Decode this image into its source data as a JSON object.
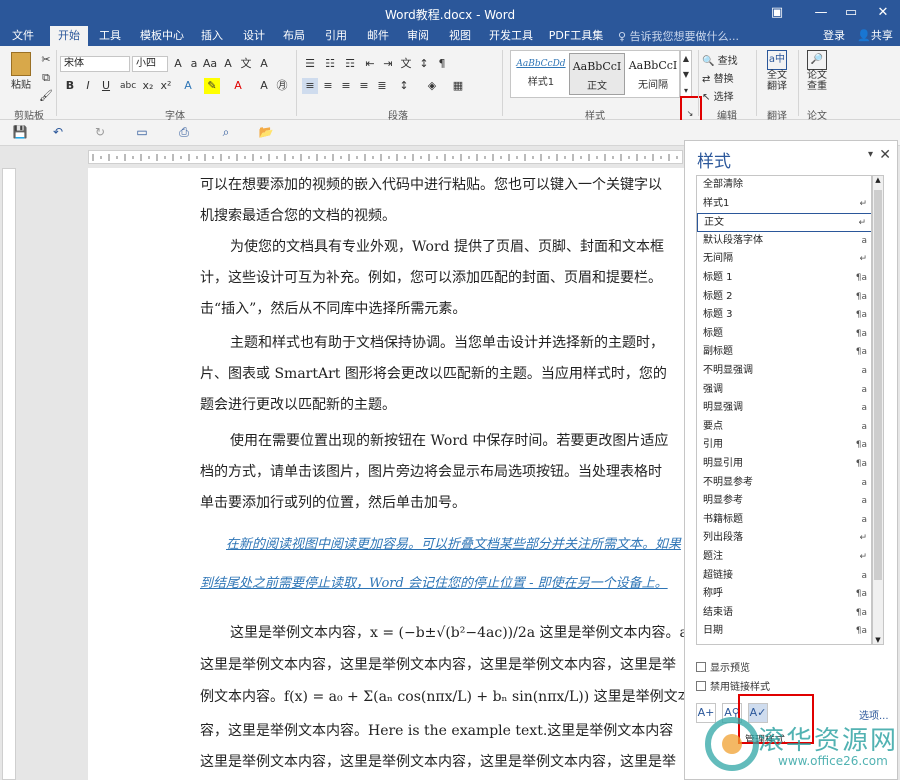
{
  "window": {
    "title": "Word教程.docx - Word"
  },
  "tabs": [
    "文件",
    "开始",
    "工具",
    "模板中心",
    "插入",
    "设计",
    "布局",
    "引用",
    "邮件",
    "审阅",
    "视图",
    "开发工具",
    "PDF工具集"
  ],
  "tellme": "告诉我您想要做什么...",
  "account": {
    "login": "登录",
    "share": "共享"
  },
  "ribbon": {
    "clipboard": {
      "paste": "粘贴",
      "label": "剪贴板"
    },
    "font": {
      "name": "宋体",
      "size": "小四",
      "label": "字体"
    },
    "paragraph": {
      "label": "段落"
    },
    "styles": {
      "label": "样式",
      "gallery": [
        {
          "preview": "AaBbCcDd",
          "name": "样式1"
        },
        {
          "preview": "AaBbCcI",
          "name": "正文"
        },
        {
          "preview": "AaBbCcI",
          "name": "无间隔"
        }
      ]
    },
    "editing": {
      "find": "查找",
      "replace": "替换",
      "select": "选择",
      "label": "编辑"
    },
    "translate": {
      "button": "全文翻译",
      "label": "翻译"
    },
    "paper": {
      "button": "论文查重",
      "label": "论文"
    }
  },
  "document": {
    "paragraphs": [
      "可以在想要添加的视频的嵌入代码中进行粘贴。您也可以键入一个关键字以",
      "机搜索最适合您的文档的视频。",
      "为使您的文档具有专业外观，Word 提供了页眉、页脚、封面和文本框",
      "计，这些设计可互为补充。例如，您可以添加匹配的封面、页眉和提要栏。",
      "击“插入”，然后从不同库中选择所需元素。",
      "主题和样式也有助于文档保持协调。当您单击设计并选择新的主题时，",
      "片、图表或 SmartArt 图形将会更改以匹配新的主题。当应用样式时，您的",
      "题会进行更改以匹配新的主题。",
      "使用在需要位置出现的新按钮在 Word 中保存时间。若要更改图片适应",
      "档的方式，请单击该图片，图片旁边将会显示布局选项按钮。当处理表格时",
      "单击要添加行或列的位置，然后单击加号。",
      "在新的阅读视图中阅读更加容易。可以折叠文档某些部分并关注所需文本。如果",
      "到结尾处之前需要停止读取，Word 会记住您的停止位置 - 即使在另一个设备上。",
      "这里是举例文本内容，x = (−b±√(b²−4ac))/2a 这里是举例文本内容。a² + b² =",
      "这里是举例文本内容，这里是举例文本内容，这里是举例文本内容，这里是举",
      "例文本内容。f(x) = a₀ + Σ(aₙ cos(nπx/L) + bₙ sin(nπx/L)) 这里是举例文本内",
      "容，这里是举例文本内容。Here is the example text.这里是举例文本内容",
      "这里是举例文本内容，这里是举例文本内容，这里是举例文本内容，这里是举"
    ]
  },
  "styles_pane": {
    "title": "样式",
    "items": [
      {
        "name": "全部清除",
        "mark": ""
      },
      {
        "name": "样式1",
        "mark": "↵"
      },
      {
        "name": "正文",
        "mark": "↵"
      },
      {
        "name": "默认段落字体",
        "mark": "a"
      },
      {
        "name": "无间隔",
        "mark": "↵"
      },
      {
        "name": "标题 1",
        "mark": "¶a"
      },
      {
        "name": "标题 2",
        "mark": "¶a"
      },
      {
        "name": "标题 3",
        "mark": "¶a"
      },
      {
        "name": "标题",
        "mark": "¶a"
      },
      {
        "name": "副标题",
        "mark": "¶a"
      },
      {
        "name": "不明显强调",
        "mark": "a"
      },
      {
        "name": "强调",
        "mark": "a"
      },
      {
        "name": "明显强调",
        "mark": "a"
      },
      {
        "name": "要点",
        "mark": "a"
      },
      {
        "name": "引用",
        "mark": "¶a"
      },
      {
        "name": "明显引用",
        "mark": "¶a"
      },
      {
        "name": "不明显参考",
        "mark": "a"
      },
      {
        "name": "明显参考",
        "mark": "a"
      },
      {
        "name": "书籍标题",
        "mark": "a"
      },
      {
        "name": "列出段落",
        "mark": "↵"
      },
      {
        "name": "题注",
        "mark": "↵"
      },
      {
        "name": "超链接",
        "mark": "a"
      },
      {
        "name": "称呼",
        "mark": "¶a"
      },
      {
        "name": "结束语",
        "mark": "¶a"
      },
      {
        "name": "日期",
        "mark": "¶a"
      }
    ],
    "show_preview": "显示预览",
    "disable_linked": "禁用链接样式",
    "manage_styles": "管理样式",
    "options": "选项..."
  },
  "watermark": {
    "text": "滚华资源网",
    "url": "www.office26.com"
  },
  "colors": {
    "brand": "#2b579a",
    "highlight": "#e00000"
  }
}
